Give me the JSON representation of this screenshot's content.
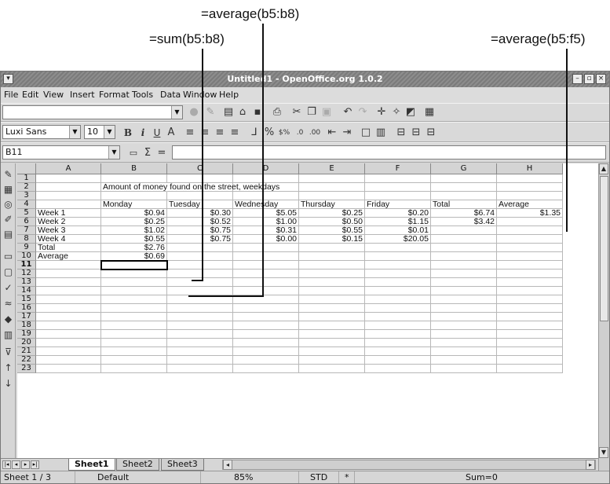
{
  "annotations": {
    "average_b": "=average(b5:b8)",
    "sum_b": "=sum(b5:b8)",
    "average_row": "=average(b5:f5)"
  },
  "window": {
    "title": "Untitled1 - OpenOffice.org 1.0.2",
    "minimize_glyph": "–",
    "maximize_glyph": "▫",
    "close_glyph": "×"
  },
  "menu": [
    "File",
    "Edit",
    "View",
    "Insert",
    "Format",
    "Tools",
    "Data",
    "Window",
    "Help"
  ],
  "toolbar": {
    "url_value": "",
    "font_name": "Luxi Sans",
    "font_size": "10",
    "bold": "B",
    "italic": "i",
    "underline": "U",
    "sum_symbol": "Σ",
    "equals_symbol": "="
  },
  "formula_bar": {
    "cell_ref": "B11",
    "content": ""
  },
  "sheet": {
    "columns": [
      "A",
      "B",
      "C",
      "D",
      "E",
      "F",
      "G",
      "H"
    ],
    "rows": [
      {
        "n": "1",
        "cells": [
          "",
          "",
          "",
          "",
          "",
          "",
          "",
          ""
        ]
      },
      {
        "n": "2",
        "cells": [
          "",
          "Amount of money found on the street, weekdays",
          "",
          "",
          "",
          "",
          "",
          ""
        ]
      },
      {
        "n": "3",
        "cells": [
          "",
          "",
          "",
          "",
          "",
          "",
          "",
          ""
        ]
      },
      {
        "n": "4",
        "cells": [
          "",
          "Monday",
          "Tuesday",
          "Wednesday",
          "Thursday",
          "Friday",
          "Total",
          "Average"
        ]
      },
      {
        "n": "5",
        "cells": [
          "Week 1",
          "$0.94",
          "$0.30",
          "$5.05",
          "$0.25",
          "$0.20",
          "$6.74",
          "$1.35"
        ]
      },
      {
        "n": "6",
        "cells": [
          "Week 2",
          "$0.25",
          "$0.52",
          "$1.00",
          "$0.50",
          "$1.15",
          "$3.42",
          ""
        ]
      },
      {
        "n": "7",
        "cells": [
          "Week 3",
          "$1.02",
          "$0.75",
          "$0.31",
          "$0.55",
          "$0.01",
          "",
          ""
        ]
      },
      {
        "n": "8",
        "cells": [
          "Week 4",
          "$0.55",
          "$0.75",
          "$0.00",
          "$0.15",
          "$20.05",
          "",
          ""
        ]
      },
      {
        "n": "9",
        "cells": [
          "Total",
          "$2.76",
          "",
          "",
          "",
          "",
          "",
          ""
        ]
      },
      {
        "n": "10",
        "cells": [
          "Average",
          "$0.69",
          "",
          "",
          "",
          "",
          "",
          ""
        ]
      },
      {
        "n": "11",
        "cells": [
          "",
          "",
          "",
          "",
          "",
          "",
          "",
          ""
        ]
      },
      {
        "n": "12",
        "cells": [
          "",
          "",
          "",
          "",
          "",
          "",
          "",
          ""
        ]
      },
      {
        "n": "13",
        "cells": [
          "",
          "",
          "",
          "",
          "",
          "",
          "",
          ""
        ]
      },
      {
        "n": "14",
        "cells": [
          "",
          "",
          "",
          "",
          "",
          "",
          "",
          ""
        ]
      },
      {
        "n": "15",
        "cells": [
          "",
          "",
          "",
          "",
          "",
          "",
          "",
          ""
        ]
      },
      {
        "n": "16",
        "cells": [
          "",
          "",
          "",
          "",
          "",
          "",
          "",
          ""
        ]
      },
      {
        "n": "17",
        "cells": [
          "",
          "",
          "",
          "",
          "",
          "",
          "",
          ""
        ]
      },
      {
        "n": "18",
        "cells": [
          "",
          "",
          "",
          "",
          "",
          "",
          "",
          ""
        ]
      },
      {
        "n": "19",
        "cells": [
          "",
          "",
          "",
          "",
          "",
          "",
          "",
          ""
        ]
      },
      {
        "n": "20",
        "cells": [
          "",
          "",
          "",
          "",
          "",
          "",
          "",
          ""
        ]
      },
      {
        "n": "21",
        "cells": [
          "",
          "",
          "",
          "",
          "",
          "",
          "",
          ""
        ]
      },
      {
        "n": "22",
        "cells": [
          "",
          "",
          "",
          "",
          "",
          "",
          "",
          ""
        ]
      },
      {
        "n": "23",
        "cells": [
          "",
          "",
          "",
          "",
          "",
          "",
          "",
          ""
        ]
      }
    ],
    "selected_cell": "B11",
    "tabs": [
      "Sheet1",
      "Sheet2",
      "Sheet3"
    ],
    "active_tab": "Sheet1"
  },
  "status": {
    "sheet": "Sheet 1 / 3",
    "style": "Default",
    "zoom": "85%",
    "mode": "STD",
    "modified": "*",
    "sum": "Sum=0"
  },
  "icons": {
    "sidebar": [
      "edit-file-icon",
      "insert-object-icon",
      "navigator-icon",
      "insert-chart-icon",
      "form-icon",
      "insert-cell-icon",
      "select-icon",
      "spellcheck-icon",
      "autospell-icon",
      "find-icon",
      "datasource-icon",
      "filter-icon",
      "sort-ascending-icon",
      "sort-descending-icon"
    ]
  }
}
